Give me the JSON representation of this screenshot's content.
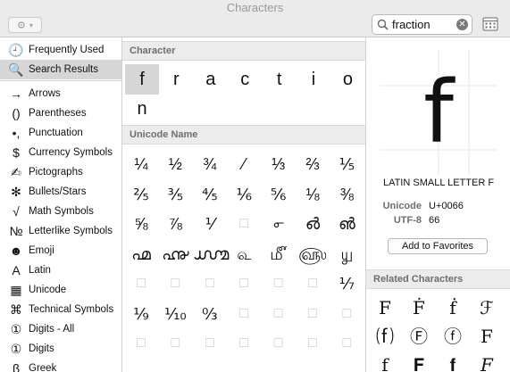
{
  "window": {
    "title": "Characters"
  },
  "toolbar": {
    "gear_icon": "gear-icon",
    "search_value": "fraction",
    "clear_icon": "clear-icon",
    "grid_icon": "grid-icon"
  },
  "sidebar": {
    "items": [
      {
        "label": "Frequently Used",
        "icon": "🕘",
        "icon_name": "clock-icon",
        "selected": false
      },
      {
        "label": "Search Results",
        "icon": "🔍",
        "icon_name": "search-icon",
        "selected": true
      },
      {
        "label": "Arrows",
        "icon": "→",
        "icon_name": "arrow-icon",
        "selected": false
      },
      {
        "label": "Parentheses",
        "icon": "()",
        "icon_name": "parentheses-icon",
        "selected": false
      },
      {
        "label": "Punctuation",
        "icon": "•,",
        "icon_name": "punctuation-icon",
        "selected": false
      },
      {
        "label": "Currency Symbols",
        "icon": "$",
        "icon_name": "dollar-icon",
        "selected": false
      },
      {
        "label": "Pictographs",
        "icon": "✍",
        "icon_name": "pictograph-icon",
        "selected": false
      },
      {
        "label": "Bullets/Stars",
        "icon": "✻",
        "icon_name": "star-icon",
        "selected": false
      },
      {
        "label": "Math Symbols",
        "icon": "√",
        "icon_name": "sqrt-icon",
        "selected": false
      },
      {
        "label": "Letterlike Symbols",
        "icon": "№",
        "icon_name": "numero-icon",
        "selected": false
      },
      {
        "label": "Emoji",
        "icon": "☻",
        "icon_name": "smiley-icon",
        "selected": false
      },
      {
        "label": "Latin",
        "icon": "A",
        "icon_name": "latin-icon",
        "selected": false
      },
      {
        "label": "Unicode",
        "icon": "▦",
        "icon_name": "unicode-icon",
        "selected": false
      },
      {
        "label": "Technical Symbols",
        "icon": "⌘",
        "icon_name": "command-icon",
        "selected": false
      },
      {
        "label": "Digits - All",
        "icon": "①",
        "icon_name": "digit-icon",
        "selected": false
      },
      {
        "label": "Digits",
        "icon": "①",
        "icon_name": "digit-icon",
        "selected": false
      },
      {
        "label": "Greek",
        "icon": "β",
        "icon_name": "greek-icon",
        "selected": false
      }
    ]
  },
  "main": {
    "character_header": "Character",
    "characters": [
      "f",
      "r",
      "a",
      "c",
      "t",
      "i",
      "o",
      "n"
    ],
    "unicode_header": "Unicode Name",
    "unicode_rows": [
      [
        "¼",
        "½",
        "¾",
        "⁄",
        "⅓",
        "⅔",
        "⅕"
      ],
      [
        "⅖",
        "⅗",
        "⅘",
        "⅙",
        "⅚",
        "⅛",
        "⅜"
      ],
      [
        "⅝",
        "⅞",
        "⅟",
        "□",
        "൳",
        "൴",
        "൵"
      ],
      [
        "൶",
        "൷",
        "൸",
        "௳",
        "௴",
        "௵",
        "௶"
      ],
      [
        "□",
        "□",
        "□",
        "□",
        "□",
        "□",
        "⅐"
      ],
      [
        "⅑",
        "⅒",
        "↉",
        "□",
        "□",
        "□",
        "□"
      ],
      [
        "□",
        "□",
        "□",
        "□",
        "□",
        "□",
        "□"
      ]
    ]
  },
  "detail": {
    "glyph": "f",
    "name": "LATIN SMALL LETTER F",
    "unicode_label": "Unicode",
    "unicode_value": "U+0066",
    "utf8_label": "UTF-8",
    "utf8_value": "66",
    "favorites_button": "Add to Favorites",
    "related_header": "Related Characters",
    "related": [
      [
        "F",
        "Ḟ",
        "ḟ",
        "ℱ"
      ],
      [
        "⒡",
        "Ⓕ",
        "ⓕ",
        "F"
      ],
      [
        "f",
        "𝐅",
        "𝐟",
        "𝐹"
      ]
    ]
  }
}
